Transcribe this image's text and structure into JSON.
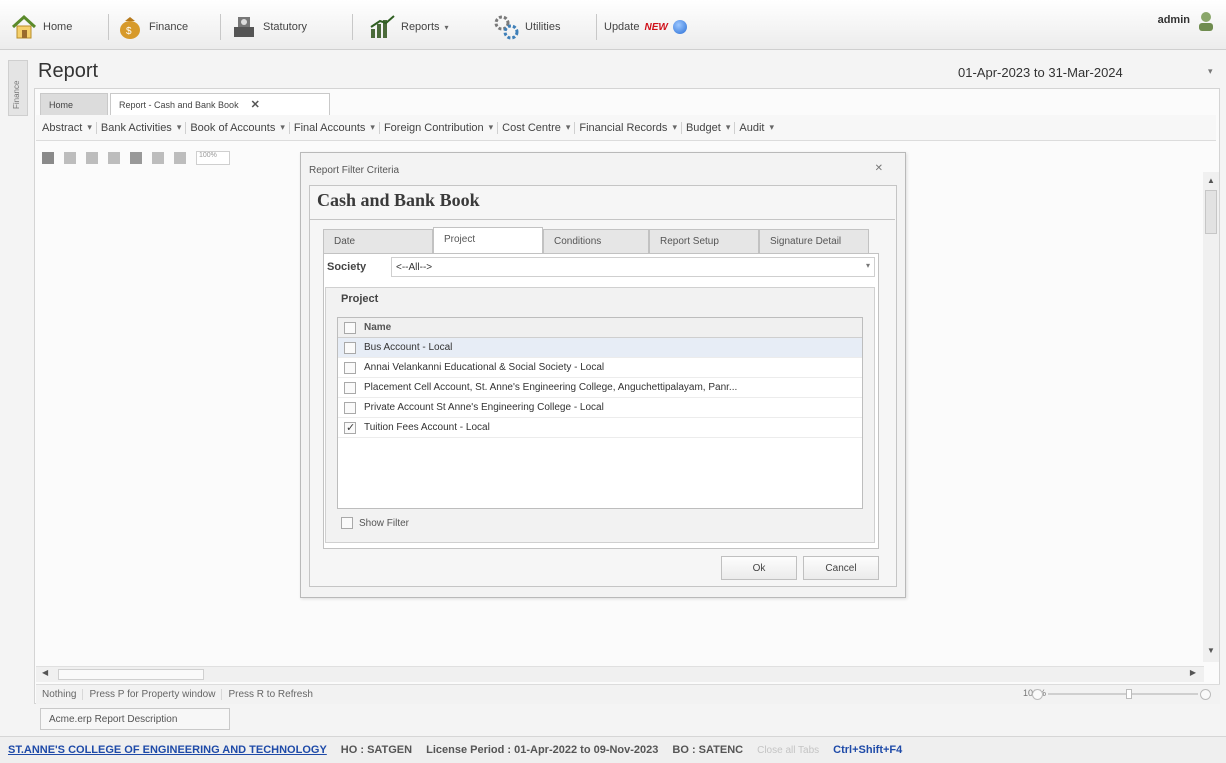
{
  "toolbar": {
    "home": "Home",
    "finance": "Finance",
    "statutory": "Statutory",
    "reports": "Reports",
    "utilities": "Utilities",
    "update": "Update",
    "new_badge": "NEW",
    "user": "admin"
  },
  "side_strip": {
    "label": "Finance"
  },
  "report": {
    "title": "Report",
    "period": "01-Apr-2023 to 31-Mar-2024"
  },
  "tabs": {
    "home": "Home",
    "active": "Report - Cash and Bank Book",
    "close": "✕"
  },
  "menu": [
    {
      "label": "Abstract"
    },
    {
      "label": "Bank Activities"
    },
    {
      "label": "Book of Accounts"
    },
    {
      "label": "Final Accounts"
    },
    {
      "label": "Foreign Contribution"
    },
    {
      "label": "Cost Centre"
    },
    {
      "label": "Financial Records"
    },
    {
      "label": "Budget"
    },
    {
      "label": "Audit"
    }
  ],
  "iconbar": {
    "zoom_value": "100%"
  },
  "dialog": {
    "caption": "Report Filter Criteria",
    "heading": "Cash and Bank Book",
    "tabs": [
      "Date",
      "Project",
      "Conditions",
      "Report Setup",
      "Signature Detail"
    ],
    "active_tab": "Project",
    "society_label": "Society",
    "society_value": "<--All-->",
    "project_header": "Project",
    "grid_header": "Name",
    "projects": [
      {
        "name": "Bus Account - Local",
        "checked": false
      },
      {
        "name": "Annai Velankanni Educational & Social Society - Local",
        "checked": false
      },
      {
        "name": "Placement Cell Account, St. Anne's Engineering College, Anguchettipalayam, Panr...",
        "checked": false
      },
      {
        "name": "Private Account St Anne's Engineering College - Local",
        "checked": false
      },
      {
        "name": "Tuition Fees Account - Local",
        "checked": true
      }
    ],
    "show_filter": "Show Filter",
    "ok": "Ok",
    "cancel": "Cancel"
  },
  "status": {
    "nothing": "Nothing",
    "press_p": "Press P for Property window",
    "press_r": "Press R to Refresh",
    "zoom": "100%"
  },
  "bottom_tab": "Acme.erp Report Description",
  "footer": {
    "college": "ST.ANNE'S COLLEGE OF ENGINEERING AND TECHNOLOGY",
    "ho": "HO : SATGEN",
    "license": "License Period : 01-Apr-2022 to 09-Nov-2023",
    "bo": "BO : SATENC",
    "close_all": "Close all Tabs",
    "shortcut": "Ctrl+Shift+F4"
  },
  "colors": {
    "link_blue": "#1e4aa8",
    "new_red": "#d0101a",
    "selected_row": "#e7edf6"
  }
}
